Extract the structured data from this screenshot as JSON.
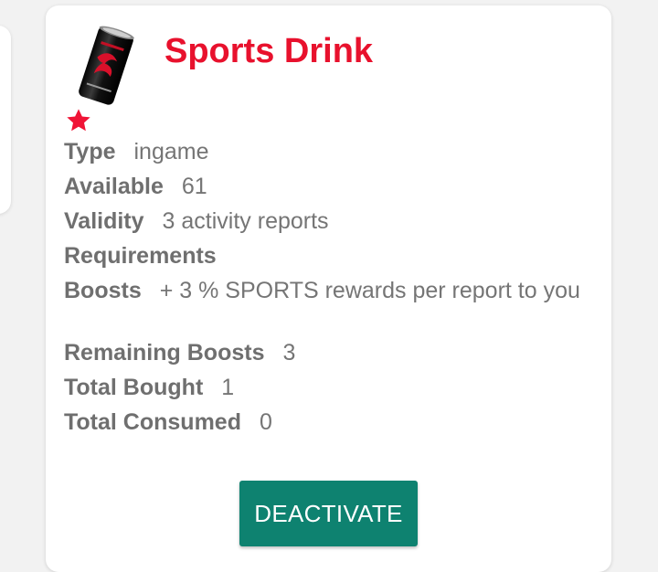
{
  "item": {
    "name": "Sports Drink",
    "image_icon": "energy-drink-can-icon",
    "favorite_icon": "star-icon",
    "accent_color": "#e8112d"
  },
  "details": {
    "type_label": "Type",
    "type_value": "ingame",
    "available_label": "Available",
    "available_value": "61",
    "validity_label": "Validity",
    "validity_value": "3 activity reports",
    "requirements_label": "Requirements",
    "requirements_value": "",
    "boosts_label": "Boosts",
    "boosts_value": "+ 3 % SPORTS rewards per report to you",
    "remaining_label": "Remaining Boosts",
    "remaining_value": "3",
    "bought_label": "Total Bought",
    "bought_value": "1",
    "consumed_label": "Total Consumed",
    "consumed_value": "0"
  },
  "actions": {
    "deactivate_label": "DEACTIVATE",
    "button_color": "#0e8270"
  }
}
